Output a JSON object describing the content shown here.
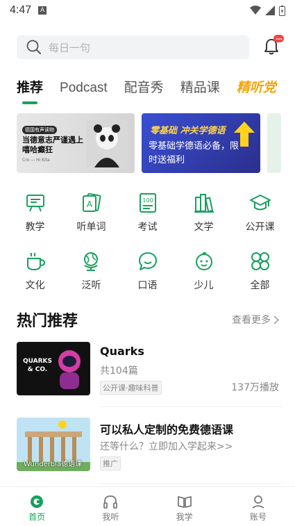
{
  "status": {
    "time": "4:47",
    "a_badge": "A"
  },
  "search": {
    "placeholder": "每日一句"
  },
  "tabs": [
    {
      "label": "推荐",
      "active": true
    },
    {
      "label": "Podcast"
    },
    {
      "label": "配音秀"
    },
    {
      "label": "精品课"
    },
    {
      "label": "精听党",
      "special": true
    }
  ],
  "banners": [
    {
      "tag": "德国有声读物",
      "title": "当德意志严谨遇上嘻哈癫狂",
      "credit": "Cro — Hi Kita"
    },
    {
      "title": "零基础 冲关学德语",
      "subtitle": "零基础学德语必备，限时送福利"
    }
  ],
  "categories": [
    {
      "label": "教学",
      "icon": "teaching-icon"
    },
    {
      "label": "听单词",
      "icon": "word-card-icon"
    },
    {
      "label": "考试",
      "icon": "exam-icon"
    },
    {
      "label": "文学",
      "icon": "books-icon"
    },
    {
      "label": "公开课",
      "icon": "graduation-cap-icon"
    },
    {
      "label": "文化",
      "icon": "coffee-cup-icon"
    },
    {
      "label": "泛听",
      "icon": "globe-icon"
    },
    {
      "label": "口语",
      "icon": "speech-bubble-icon"
    },
    {
      "label": "少儿",
      "icon": "child-face-icon"
    },
    {
      "label": "全部",
      "icon": "clover-icon"
    }
  ],
  "hot": {
    "title": "热门推荐",
    "more": "查看更多"
  },
  "cards": [
    {
      "name": "Quarks",
      "sub": "共104篇",
      "chip": "公开课·趣味科普",
      "plays": "137万播放",
      "thumb_text": "QUARKS & CO."
    },
    {
      "name": "可以私人定制的免费德语课",
      "sub": "还等什么？立即加入学起来>>",
      "chip": "推广",
      "thumb_text": "Wunderbla德语课"
    }
  ],
  "nav": [
    {
      "label": "首页",
      "active": true
    },
    {
      "label": "我听"
    },
    {
      "label": "我学"
    },
    {
      "label": "账号"
    }
  ],
  "colors": {
    "accent": "#17a05d",
    "tab_special": "#f5a50b",
    "badge": "#f04848"
  }
}
